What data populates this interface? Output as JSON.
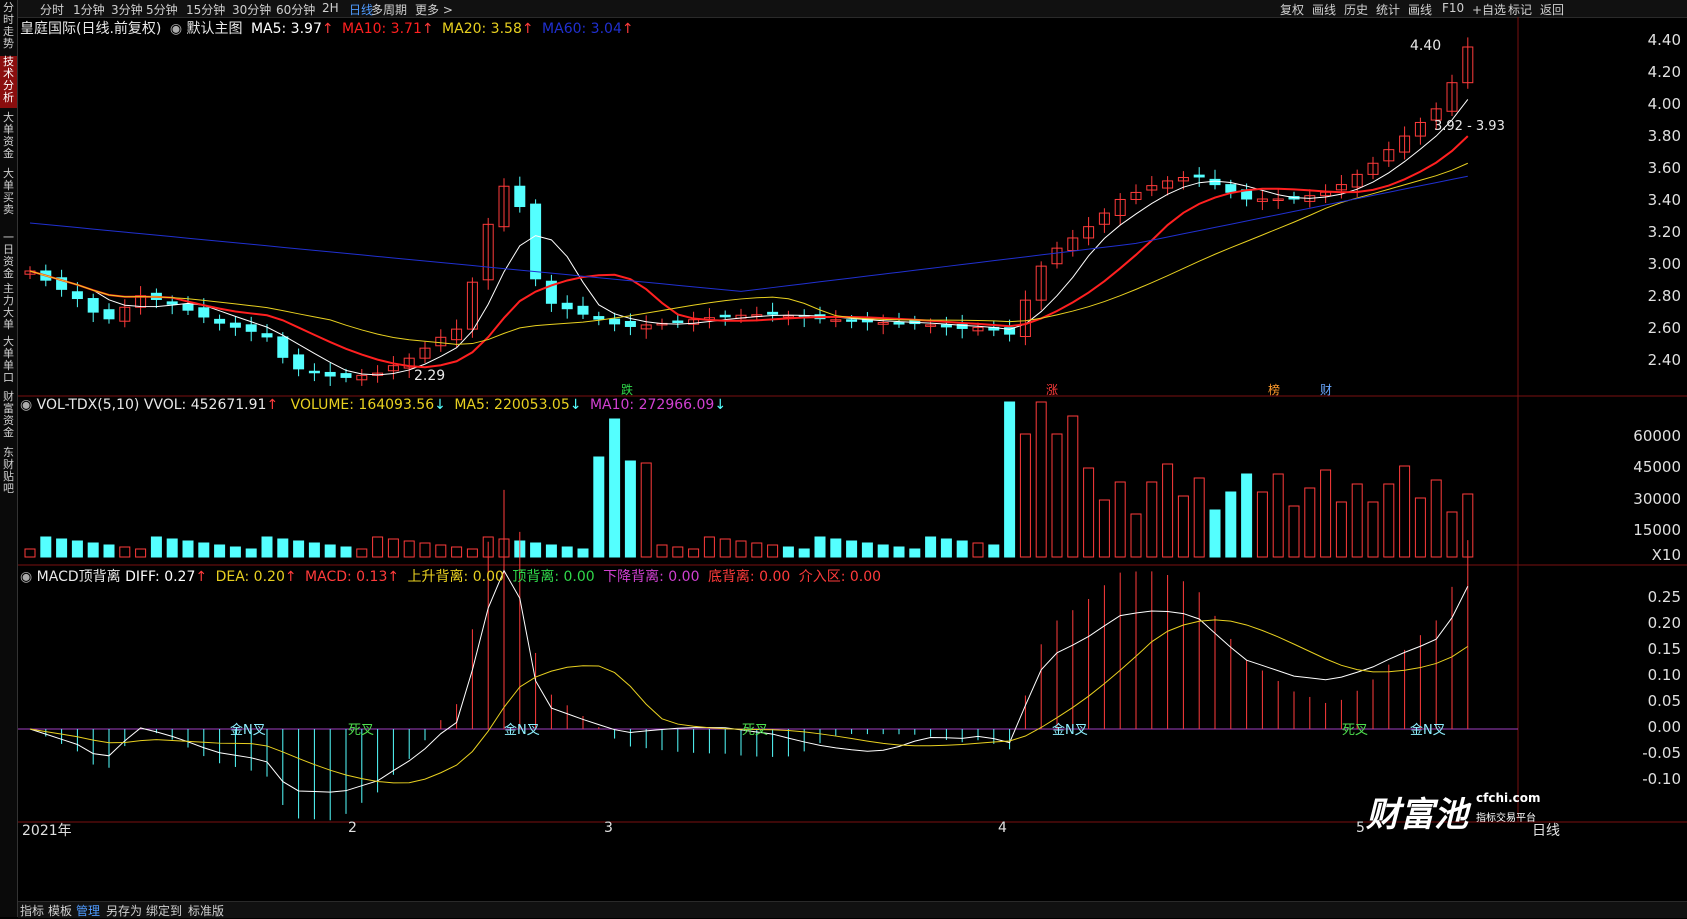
{
  "sidebar": [
    "分时走势",
    "技术分析",
    "大单资金",
    "大单买卖",
    "一日资金",
    "主力大单",
    "大单单口",
    "财富资金",
    "东财贴吧"
  ],
  "sidebar_active": 1,
  "periods": [
    "分时",
    "1分钟",
    "3分钟",
    "5分钟",
    "15分钟",
    "30分钟",
    "60分钟",
    "2H",
    "日线",
    "多周期",
    "更多 >"
  ],
  "period_active": 8,
  "right_tools": [
    "复权",
    "画线",
    "历史",
    "统计",
    "画线",
    "F10",
    "+自选",
    "标记",
    "返回"
  ],
  "main": {
    "stock": "皇庭国际(日线.前复权)",
    "theme": "默认主图",
    "ma5": "MA5: 3.97",
    "ma10": "MA10: 3.71",
    "ma20": "MA20: 3.58",
    "ma60": "MA60: 3.04",
    "high_label": "4.40",
    "low_label": "2.29",
    "range_label": "3.92 - 3.93",
    "axis": [
      "4.40",
      "4.20",
      "4.00",
      "3.80",
      "3.60",
      "3.40",
      "3.20",
      "3.00",
      "2.80",
      "2.60",
      "2.40"
    ],
    "markers": [
      {
        "text": "跌",
        "color": "#2fd84a"
      },
      {
        "text": "涨",
        "color": "#ff3b3b"
      },
      {
        "text": "榜",
        "color": "#ff9a2a"
      },
      {
        "text": "财",
        "color": "#6aa8ff"
      }
    ]
  },
  "vol": {
    "title": "VOL-TDX(5,10)",
    "vvol": "VVOL: 452671.91",
    "volume": "VOLUME: 164093.56",
    "ma5": "MA5: 220053.05",
    "ma10": "MA10: 272966.09",
    "axis": [
      "60000",
      "45000",
      "30000",
      "15000",
      "X10"
    ]
  },
  "macd": {
    "title": "MACD顶背离",
    "diff": "DIFF: 0.27",
    "dea": "DEA: 0.20",
    "macd": "MACD: 0.13",
    "up_div": "上升背离: 0.00",
    "top_div": "顶背离: 0.00",
    "down_div": "下降背离: 0.00",
    "bottom_div": "底背离: 0.00",
    "entry": "介入区: 0.00",
    "axis": [
      "0.25",
      "0.20",
      "0.15",
      "0.10",
      "0.05",
      "0.00",
      "-0.05",
      "-0.10"
    ],
    "labels": [
      {
        "text": "金N叉",
        "color": "#8ff0ff"
      },
      {
        "text": "死叉",
        "color": "#4fe04f"
      },
      {
        "text": "金N叉",
        "color": "#8ff0ff"
      },
      {
        "text": "死叉",
        "color": "#4fe04f"
      },
      {
        "text": "金N叉",
        "color": "#8ff0ff"
      },
      {
        "text": "死叉",
        "color": "#4fe04f"
      },
      {
        "text": "金N叉",
        "color": "#8ff0ff"
      }
    ]
  },
  "date_axis": [
    "2021年",
    "2",
    "3",
    "4",
    "5"
  ],
  "date_right": "日线",
  "bottom_tabs": [
    "指标",
    "模板",
    "管理",
    "另存为",
    "绑定到",
    "标准版"
  ],
  "bottom_active": 2,
  "watermark": {
    "brand": "财富池",
    "url": "cfchi.com",
    "sub": "指标交易平台"
  },
  "colors": {
    "up": "#ff3b3b",
    "down": "#54ffff",
    "ma5": "#ffffff",
    "ma10": "#ff2020",
    "ma20": "#e8d020",
    "ma60": "#2030d0",
    "dea": "#e8d020"
  }
}
